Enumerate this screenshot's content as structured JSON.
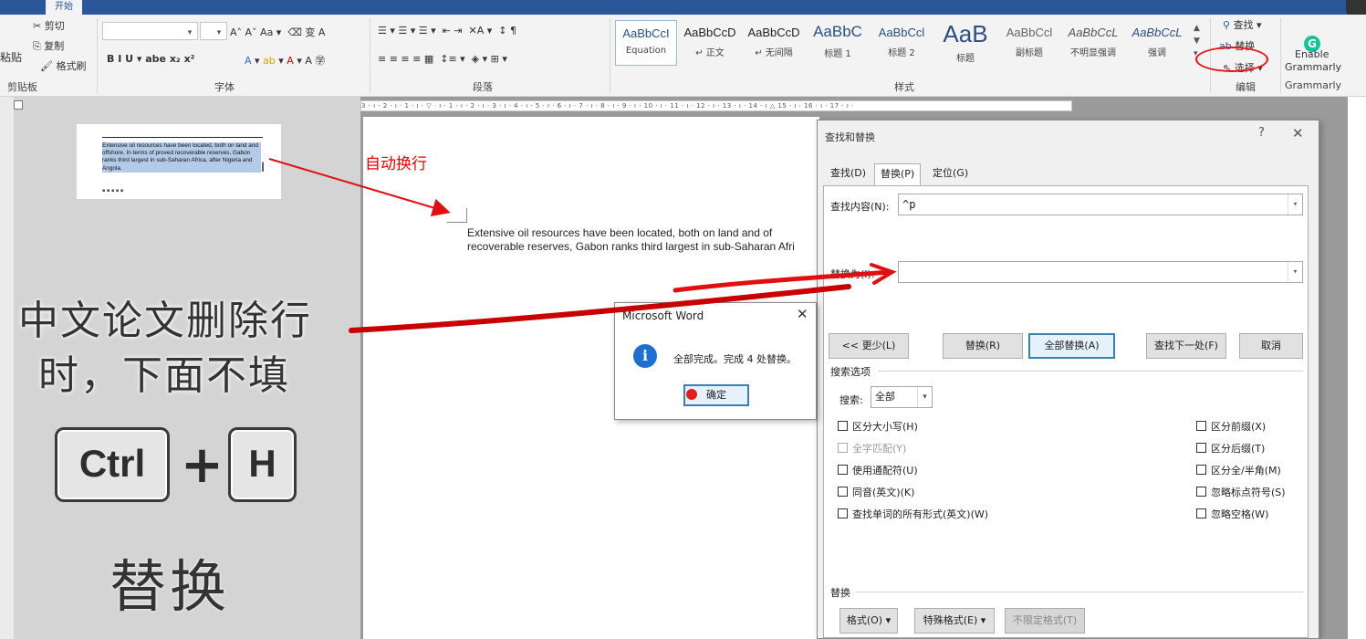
{
  "ribbon_tabs": {
    "active": "开始"
  },
  "clipboard": {
    "cut": "剪切",
    "copy": "复制",
    "paste": "粘贴",
    "format_painter": "格式刷",
    "group": "剪贴板"
  },
  "font": {
    "group": "字体",
    "buttons": "B  I  U ▾ abe x₂ x²"
  },
  "paragraph": {
    "group": "段落"
  },
  "styles": {
    "group": "样式",
    "items": [
      {
        "sample": "AaBbCcI",
        "name": "Equation"
      },
      {
        "sample": "AaBbCcD",
        "name": "↵ 正文"
      },
      {
        "sample": "AaBbCcD",
        "name": "↵ 无间隔"
      },
      {
        "sample": "AaBbC",
        "name": "标题 1"
      },
      {
        "sample": "AaBbCcl",
        "name": "标题 2"
      },
      {
        "sample": "AaB",
        "name": "标题"
      },
      {
        "sample": "AaBbCcl",
        "name": "副标题"
      },
      {
        "sample": "AaBbCcL",
        "name": "不明显强调"
      },
      {
        "sample": "AaBbCcL",
        "name": "强调"
      }
    ]
  },
  "editing": {
    "find": "查找 ▾",
    "replace": "替换",
    "select": "选择 ▾",
    "group": "编辑"
  },
  "grammarly": {
    "enable": "Enable",
    "name": "Grammarly",
    "group": "Grammarly"
  },
  "ruler": {
    "ticks": "3 · ı · 2 · ı · 1 · ı · ▽ · ı · 1 · ı · 2 · ı · 3 · ı · 4 · ı · 5 · ı · 6 · ı · 7 · ı · 8 · ı · 9 · ı · 10 · ı · 11 · ı · 12 · ı · 13 · ı · 14 · ı △ 15 · ı · 16 · ı · 17 · ı ·"
  },
  "thumbnail": {
    "text": "Extensive oil resources have been located, both on land and offshore. In terms of proved recoverable reserves, Gabon ranks third largest in sub-Saharan Africa, after Nigeria and Angola."
  },
  "annotations": {
    "auto_wrap": "自动换行",
    "note_line1": "中文论文删除行",
    "note_line2": "时，下面不填",
    "key_ctrl": "Ctrl",
    "key_plus": "+",
    "key_h": "H",
    "replace": "替换"
  },
  "document": {
    "line1": "Extensive oil resources have been located, both on land and of",
    "line2": "recoverable reserves, Gabon ranks third largest in sub-Saharan Afri"
  },
  "find_replace": {
    "title": "查找和替换",
    "help": "?",
    "close": "✕",
    "tabs": [
      "查找(D)",
      "替换(P)",
      "定位(G)"
    ],
    "find_label": "查找内容(N):",
    "find_value": "^p",
    "replace_label": "替换为(I):",
    "replace_value": "",
    "buttons": {
      "less": "<< 更少(L)",
      "replace": "替换(R)",
      "replace_all": "全部替换(A)",
      "find_next": "查找下一处(F)",
      "cancel": "取消"
    },
    "search_options": "搜索选项",
    "search_label": "搜索:",
    "search_value": "全部",
    "left_options": [
      "区分大小写(H)",
      "全字匹配(Y)",
      "使用通配符(U)",
      "同音(英文)(K)",
      "查找单词的所有形式(英文)(W)"
    ],
    "right_options": [
      "区分前缀(X)",
      "区分后缀(T)",
      "区分全/半角(M)",
      "忽略标点符号(S)",
      "忽略空格(W)"
    ],
    "replace_section": "替换",
    "bottom_buttons": [
      "格式(O) ▾",
      "特殊格式(E) ▾",
      "不限定格式(T)"
    ]
  },
  "msgbox": {
    "title": "Microsoft Word",
    "close": "✕",
    "message": "全部完成。完成 4 处替换。",
    "ok": "确定"
  }
}
